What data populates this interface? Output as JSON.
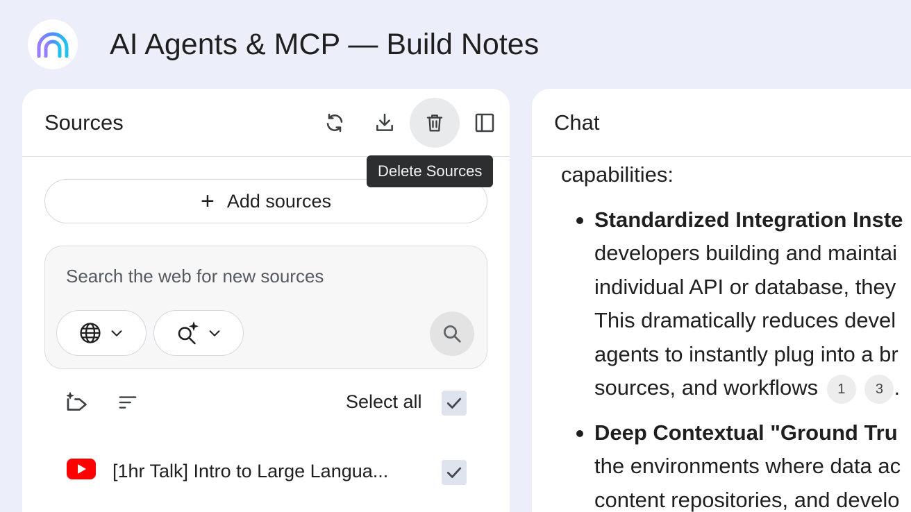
{
  "header": {
    "title": "AI Agents & MCP — Build Notes",
    "logo_icon": "rainbow-arc-logo-icon"
  },
  "sources": {
    "title": "Sources",
    "actions": [
      {
        "name": "refresh-icon"
      },
      {
        "name": "download-icon"
      },
      {
        "name": "delete-icon",
        "hovered": true
      },
      {
        "name": "collapse-panel-icon"
      }
    ],
    "tooltip": "Delete Sources",
    "add_label": "Add sources",
    "search": {
      "placeholder": "Search the web for new sources",
      "chips": [
        {
          "icon": "globe-icon"
        },
        {
          "icon": "research-sparkle-icon"
        }
      ]
    },
    "select_all_label": "Select all",
    "select_all_checked": true,
    "items": [
      {
        "title": "[1hr Talk] Intro to Large Langua...",
        "icon": "youtube-icon",
        "checked": true
      }
    ]
  },
  "chat": {
    "title": "Chat",
    "intro": "capabilities:",
    "bullets": [
      {
        "bold": "Standardized Integration Inste",
        "lines": [
          "developers building and maintai",
          "individual API or database, they",
          "This dramatically reduces devel",
          "agents to instantly plug into a br"
        ],
        "last_line": "sources, and workflows",
        "citations": [
          "1",
          "3"
        ],
        "tail": "."
      },
      {
        "bold": "Deep Contextual \"Ground Tru",
        "lines": [
          "the environments where data ac",
          "content repositories, and develo"
        ]
      }
    ]
  },
  "colors": {
    "background": "#eceff9",
    "panel": "#ffffff",
    "tooltip_bg": "#2d2e30",
    "youtube_red": "#ff0000",
    "checkbox_bg": "#dfe3ee"
  }
}
